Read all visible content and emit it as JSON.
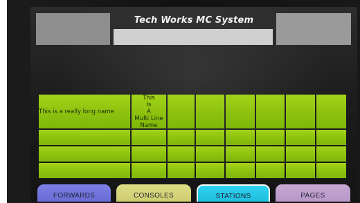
{
  "header": {
    "title": "Tech Works MC System",
    "search_value": ""
  },
  "grid": {
    "rows": [
      [
        "This is a really long name",
        "This\nIs\nA\nMulti Line\nName",
        "",
        "",
        "",
        "",
        "",
        ""
      ],
      [
        "",
        "",
        "",
        "",
        "",
        "",
        "",
        ""
      ],
      [
        "",
        "",
        "",
        "",
        "",
        "",
        "",
        ""
      ],
      [
        "",
        "",
        "",
        "",
        "",
        "",
        "",
        ""
      ]
    ]
  },
  "tabs": [
    {
      "label": "FORWARDS",
      "color": "#6f71db"
    },
    {
      "label": "CONSOLES",
      "color": "#d4d377"
    },
    {
      "label": "STATIONS",
      "color": "#25c6e4",
      "active": true
    },
    {
      "label": "PAGES",
      "color": "#bd9ecb"
    }
  ],
  "colors": {
    "cell_green": "#94c812",
    "screen_bg": "#1d1d1d"
  }
}
